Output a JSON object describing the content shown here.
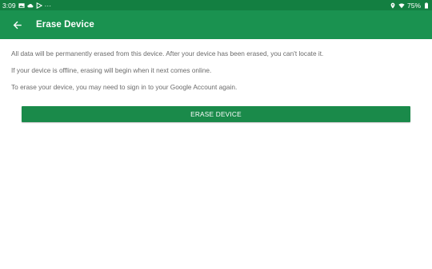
{
  "status_bar": {
    "time": "3:09",
    "overflow": "···",
    "battery": "75%",
    "left_icons": [
      "image-icon",
      "cloud-icon",
      "play-store-icon"
    ],
    "right_icons": [
      "location-icon",
      "wifi-icon",
      "battery-icon"
    ],
    "color": "#137f41"
  },
  "app_bar": {
    "title": "Erase Device",
    "back_icon": "arrow-back-icon",
    "color": "#1a9250"
  },
  "content": {
    "paragraphs": [
      "All data will be permanently erased from this device. After your device has been erased, you can't locate it.",
      "If your device is offline, erasing will begin when it next comes online.",
      "To erase your device, you may need to sign in to your Google Account again."
    ]
  },
  "erase_button": {
    "label": "ERASE DEVICE",
    "color": "#1a8a4a"
  }
}
